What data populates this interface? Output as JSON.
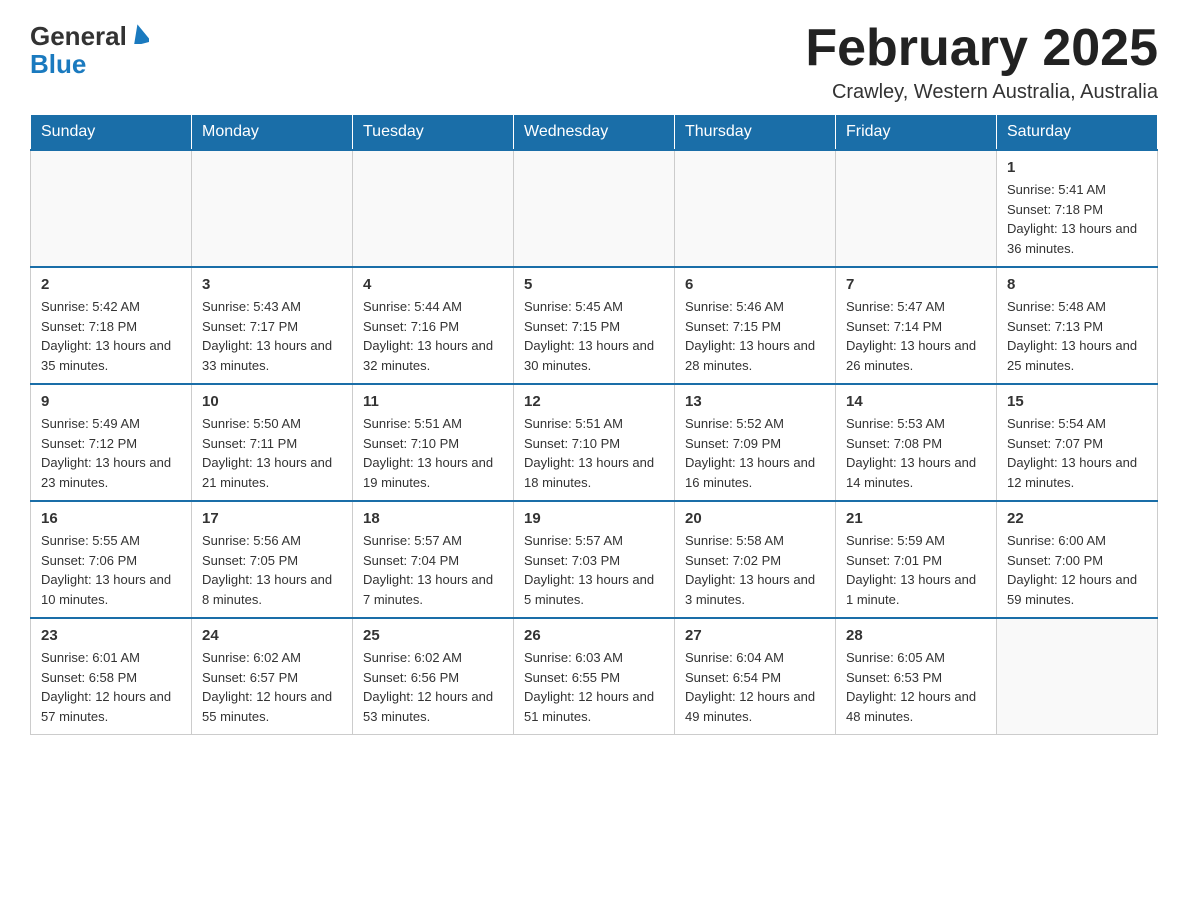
{
  "header": {
    "logo_general": "General",
    "logo_blue": "Blue",
    "month_title": "February 2025",
    "location": "Crawley, Western Australia, Australia"
  },
  "days_of_week": [
    "Sunday",
    "Monday",
    "Tuesday",
    "Wednesday",
    "Thursday",
    "Friday",
    "Saturday"
  ],
  "weeks": [
    {
      "days": [
        {
          "num": "",
          "info": ""
        },
        {
          "num": "",
          "info": ""
        },
        {
          "num": "",
          "info": ""
        },
        {
          "num": "",
          "info": ""
        },
        {
          "num": "",
          "info": ""
        },
        {
          "num": "",
          "info": ""
        },
        {
          "num": "1",
          "info": "Sunrise: 5:41 AM\nSunset: 7:18 PM\nDaylight: 13 hours and 36 minutes."
        }
      ]
    },
    {
      "days": [
        {
          "num": "2",
          "info": "Sunrise: 5:42 AM\nSunset: 7:18 PM\nDaylight: 13 hours and 35 minutes."
        },
        {
          "num": "3",
          "info": "Sunrise: 5:43 AM\nSunset: 7:17 PM\nDaylight: 13 hours and 33 minutes."
        },
        {
          "num": "4",
          "info": "Sunrise: 5:44 AM\nSunset: 7:16 PM\nDaylight: 13 hours and 32 minutes."
        },
        {
          "num": "5",
          "info": "Sunrise: 5:45 AM\nSunset: 7:15 PM\nDaylight: 13 hours and 30 minutes."
        },
        {
          "num": "6",
          "info": "Sunrise: 5:46 AM\nSunset: 7:15 PM\nDaylight: 13 hours and 28 minutes."
        },
        {
          "num": "7",
          "info": "Sunrise: 5:47 AM\nSunset: 7:14 PM\nDaylight: 13 hours and 26 minutes."
        },
        {
          "num": "8",
          "info": "Sunrise: 5:48 AM\nSunset: 7:13 PM\nDaylight: 13 hours and 25 minutes."
        }
      ]
    },
    {
      "days": [
        {
          "num": "9",
          "info": "Sunrise: 5:49 AM\nSunset: 7:12 PM\nDaylight: 13 hours and 23 minutes."
        },
        {
          "num": "10",
          "info": "Sunrise: 5:50 AM\nSunset: 7:11 PM\nDaylight: 13 hours and 21 minutes."
        },
        {
          "num": "11",
          "info": "Sunrise: 5:51 AM\nSunset: 7:10 PM\nDaylight: 13 hours and 19 minutes."
        },
        {
          "num": "12",
          "info": "Sunrise: 5:51 AM\nSunset: 7:10 PM\nDaylight: 13 hours and 18 minutes."
        },
        {
          "num": "13",
          "info": "Sunrise: 5:52 AM\nSunset: 7:09 PM\nDaylight: 13 hours and 16 minutes."
        },
        {
          "num": "14",
          "info": "Sunrise: 5:53 AM\nSunset: 7:08 PM\nDaylight: 13 hours and 14 minutes."
        },
        {
          "num": "15",
          "info": "Sunrise: 5:54 AM\nSunset: 7:07 PM\nDaylight: 13 hours and 12 minutes."
        }
      ]
    },
    {
      "days": [
        {
          "num": "16",
          "info": "Sunrise: 5:55 AM\nSunset: 7:06 PM\nDaylight: 13 hours and 10 minutes."
        },
        {
          "num": "17",
          "info": "Sunrise: 5:56 AM\nSunset: 7:05 PM\nDaylight: 13 hours and 8 minutes."
        },
        {
          "num": "18",
          "info": "Sunrise: 5:57 AM\nSunset: 7:04 PM\nDaylight: 13 hours and 7 minutes."
        },
        {
          "num": "19",
          "info": "Sunrise: 5:57 AM\nSunset: 7:03 PM\nDaylight: 13 hours and 5 minutes."
        },
        {
          "num": "20",
          "info": "Sunrise: 5:58 AM\nSunset: 7:02 PM\nDaylight: 13 hours and 3 minutes."
        },
        {
          "num": "21",
          "info": "Sunrise: 5:59 AM\nSunset: 7:01 PM\nDaylight: 13 hours and 1 minute."
        },
        {
          "num": "22",
          "info": "Sunrise: 6:00 AM\nSunset: 7:00 PM\nDaylight: 12 hours and 59 minutes."
        }
      ]
    },
    {
      "days": [
        {
          "num": "23",
          "info": "Sunrise: 6:01 AM\nSunset: 6:58 PM\nDaylight: 12 hours and 57 minutes."
        },
        {
          "num": "24",
          "info": "Sunrise: 6:02 AM\nSunset: 6:57 PM\nDaylight: 12 hours and 55 minutes."
        },
        {
          "num": "25",
          "info": "Sunrise: 6:02 AM\nSunset: 6:56 PM\nDaylight: 12 hours and 53 minutes."
        },
        {
          "num": "26",
          "info": "Sunrise: 6:03 AM\nSunset: 6:55 PM\nDaylight: 12 hours and 51 minutes."
        },
        {
          "num": "27",
          "info": "Sunrise: 6:04 AM\nSunset: 6:54 PM\nDaylight: 12 hours and 49 minutes."
        },
        {
          "num": "28",
          "info": "Sunrise: 6:05 AM\nSunset: 6:53 PM\nDaylight: 12 hours and 48 minutes."
        },
        {
          "num": "",
          "info": ""
        }
      ]
    }
  ]
}
